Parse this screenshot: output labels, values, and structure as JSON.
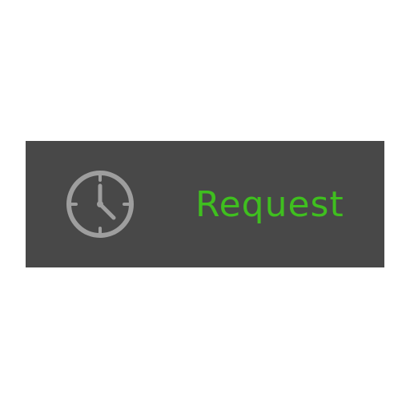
{
  "button": {
    "label": "Request",
    "label_color": "#3fbf1f",
    "background_color": "#484848",
    "icon": "clock-icon",
    "icon_color": "#9e9e9e"
  }
}
